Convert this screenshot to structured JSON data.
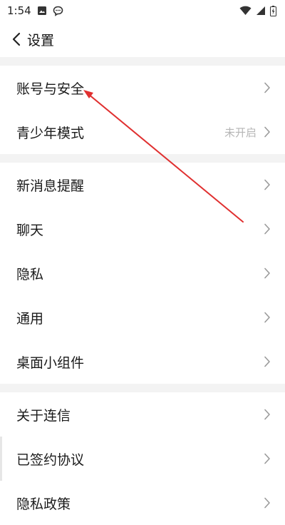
{
  "status_bar": {
    "time": "1:54",
    "icons": [
      "image-icon",
      "chat-icon",
      "wifi-icon",
      "signal-icon",
      "battery-icon"
    ]
  },
  "header": {
    "back_icon": "chevron-left-icon",
    "title": "设置"
  },
  "sections": [
    {
      "items": [
        {
          "label": "账号与安全"
        },
        {
          "label": "青少年模式",
          "value": "未开启"
        }
      ]
    },
    {
      "items": [
        {
          "label": "新消息提醒"
        },
        {
          "label": "聊天"
        },
        {
          "label": "隐私"
        },
        {
          "label": "通用"
        },
        {
          "label": "桌面小组件"
        }
      ]
    },
    {
      "items": [
        {
          "label": "关于连信"
        },
        {
          "label": "已签约协议"
        },
        {
          "label": "隐私政策"
        }
      ]
    }
  ],
  "colors": {
    "background": "#ffffff",
    "section_gap": "#f3f3f3",
    "secondary_text": "#b5b5b5",
    "chevron": "#9a9a9a",
    "annotation_arrow": "#e03030"
  }
}
